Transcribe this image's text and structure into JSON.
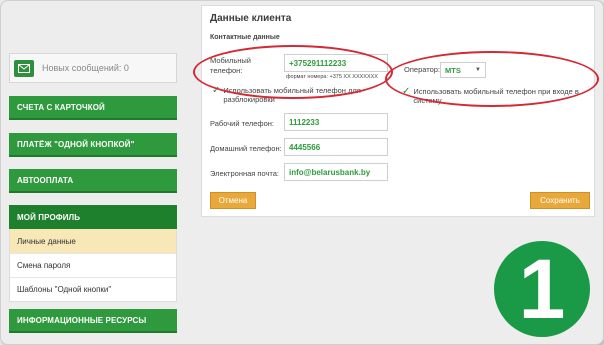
{
  "sidebar": {
    "messages": {
      "icon": "envelope-icon",
      "text": "Новых сообщений: 0"
    },
    "items": [
      {
        "label": "СЧЕТА С КАРТОЧКОЙ"
      },
      {
        "label": "ПЛАТЁЖ \"ОДНОЙ КНОПКОЙ\""
      },
      {
        "label": "АВТООПЛАТА"
      },
      {
        "label": "МОЙ ПРОФИЛЬ"
      },
      {
        "label": "ИНФОРМАЦИОННЫЕ РЕСУРСЫ"
      }
    ],
    "submenu": [
      {
        "label": "Личные данные"
      },
      {
        "label": "Смена пароля"
      },
      {
        "label": "Шаблоны \"Одной кнопки\""
      }
    ]
  },
  "form": {
    "title": "Данные клиента",
    "section": "Контактные данные",
    "mobile": {
      "label": "Мобильный телефон:",
      "value": "+375291112233",
      "hint": "формат номера: +375 XX XXXXXXX"
    },
    "operator": {
      "label": "Оператор:",
      "value": "MTS"
    },
    "unblock_checkbox": "Использовать мобильный телефон для разблокировки",
    "login_checkbox": "Использовать мобильный телефон при входе в систему",
    "work_phone": {
      "label": "Рабочий телефон:",
      "value": "1112233"
    },
    "home_phone": {
      "label": "Домашний телефон:",
      "value": "4445566"
    },
    "email": {
      "label": "Электронная почта:",
      "value": "info@belarusbank.by"
    },
    "cancel_label": "Отмена",
    "save_label": "Сохранить"
  },
  "step_badge": "1",
  "colors": {
    "accent_green": "#2e9a3d",
    "button_orange": "#e8a83a",
    "highlight_red": "#d32a35"
  }
}
